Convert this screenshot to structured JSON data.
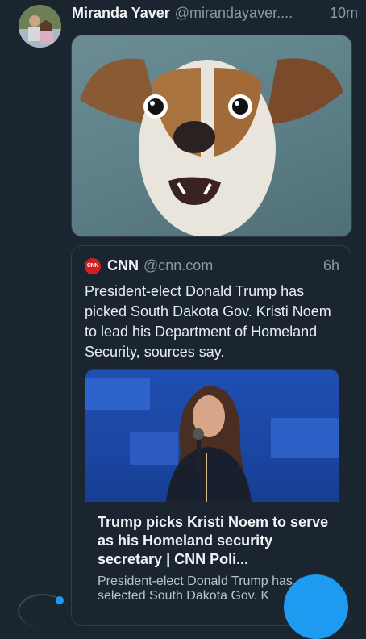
{
  "tweet": {
    "author_name": "Miranda Yaver",
    "author_handle": "@mirandayaver....",
    "time": "10m",
    "media_alt": "surprised dog"
  },
  "quote": {
    "logo_text": "CNN",
    "author_name": "CNN",
    "author_handle": "@cnn.com",
    "time": "6h",
    "text": "President-elect Donald Trump has picked South Dakota Gov. Kristi Noem to lead his Department of Homeland Security, sources say.",
    "card": {
      "title": "Trump picks Kristi Noem to serve as his Homeland security secretary | CNN Poli...",
      "description": "President-elect Donald Trump has selected South Dakota Gov. K"
    }
  },
  "colors": {
    "background": "#1b2530",
    "accent": "#1d9bf0",
    "muted": "#8b98a5",
    "cnn_red": "#d31f1f"
  },
  "icons": [
    "avatar",
    "cnn-logo-icon",
    "compose-fab"
  ]
}
